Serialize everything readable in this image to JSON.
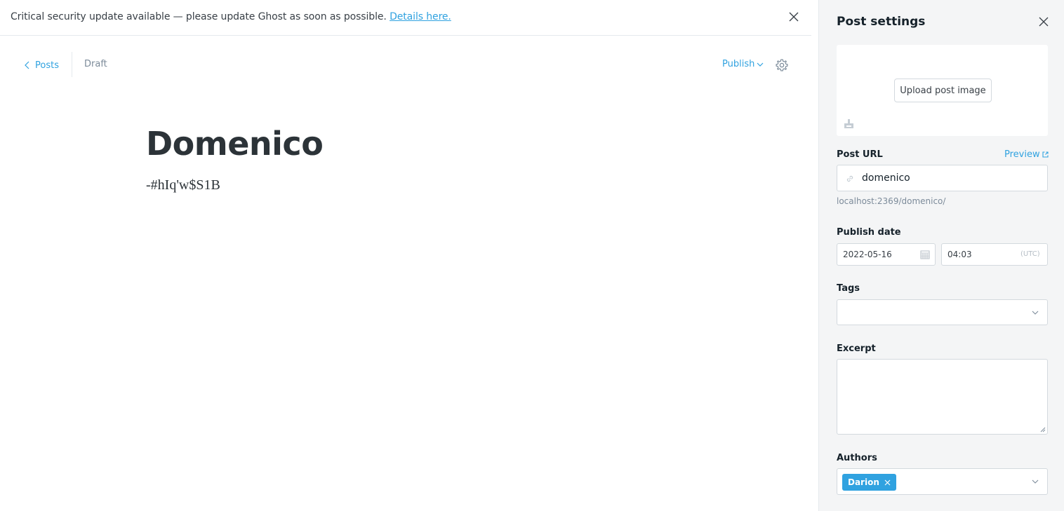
{
  "alert": {
    "message": "Critical security update available — please update Ghost as soon as possible.",
    "link_text": "Details here."
  },
  "editor": {
    "back_label": "Posts",
    "status": "Draft",
    "publish_label": "Publish",
    "title": "Domenico",
    "body": "-#hIq'w$S1B"
  },
  "settings": {
    "title": "Post settings",
    "upload_label": "Upload post image",
    "post_url": {
      "label": "Post URL",
      "preview_label": "Preview",
      "value": "domenico",
      "hint": "localhost:2369/domenico/"
    },
    "publish_date": {
      "label": "Publish date",
      "date": "2022-05-16",
      "time": "04:03",
      "timezone": "(UTC)"
    },
    "tags": {
      "label": "Tags"
    },
    "excerpt": {
      "label": "Excerpt",
      "value": ""
    },
    "authors": {
      "label": "Authors",
      "items": [
        "Darion"
      ]
    }
  },
  "colors": {
    "accent": "#30a2e0",
    "panel_bg": "#f4f5f6",
    "text": "#15212a"
  }
}
